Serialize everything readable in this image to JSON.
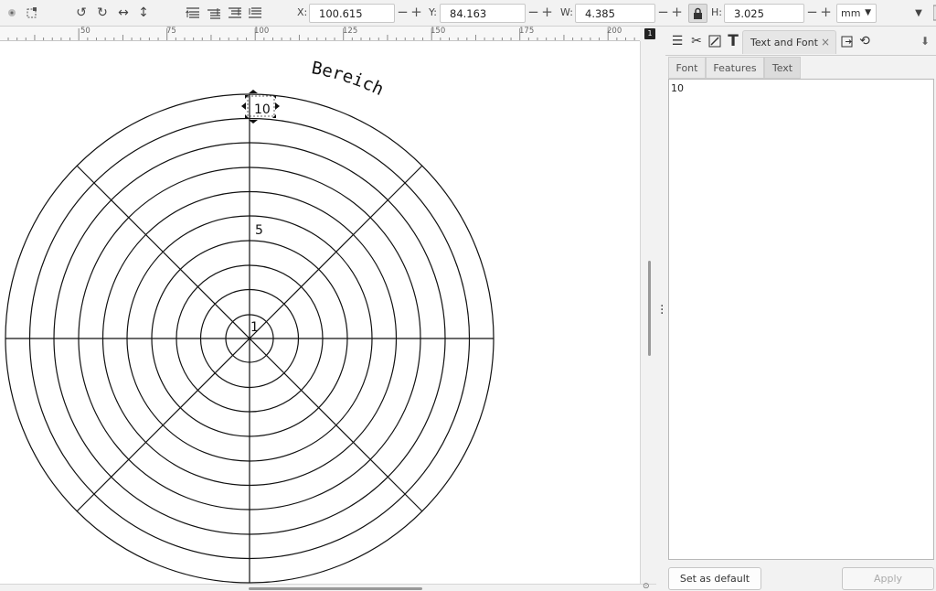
{
  "toolbar": {
    "x_label": "X:",
    "x_value": "100.615",
    "y_label": "Y:",
    "y_value": "84.163",
    "w_label": "W:",
    "w_value": "4.385",
    "h_label": "H:",
    "h_value": "3.025",
    "unit": "mm",
    "minus": "−",
    "plus": "+"
  },
  "ruler": {
    "labels": [
      "50",
      "75",
      "100",
      "125",
      "150",
      "175",
      "200"
    ]
  },
  "page_badge": "1",
  "canvas": {
    "curved_text": "Bereich",
    "label_10": "10",
    "label_5": "5",
    "label_1": "1"
  },
  "panel": {
    "dock_tab_title": "Text and Font",
    "close_glyph": "×",
    "sub_tabs": [
      "Font",
      "Features",
      "Text"
    ],
    "text_content": "10",
    "set_default_label": "Set as default",
    "apply_label": "Apply"
  },
  "colors": {
    "canvas_bg": "#ffffff",
    "line": "#111111",
    "ui_bg": "#f2f2f2"
  }
}
